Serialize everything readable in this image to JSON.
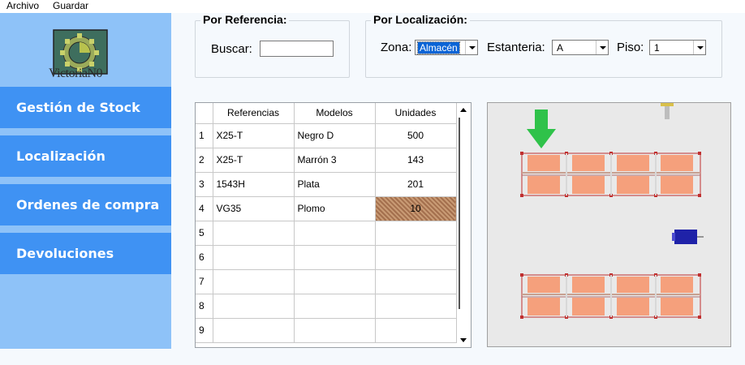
{
  "menu": {
    "items": [
      "Archivo",
      "Guardar"
    ]
  },
  "sidebar": {
    "logo_text": "VictoriaN0",
    "items": [
      {
        "label": "Gestión de Stock"
      },
      {
        "label": "Localización"
      },
      {
        "label": "Ordenes de compra"
      },
      {
        "label": "Devoluciones"
      }
    ]
  },
  "by_reference": {
    "title": "Por Referencia:",
    "search_label": "Buscar:",
    "search_value": ""
  },
  "by_location": {
    "title": "Por Localización:",
    "zone_label": "Zona:",
    "zone_value": "Almacén",
    "shelf_label": "Estanteria:",
    "shelf_value": "A",
    "floor_label": "Piso:",
    "floor_value": "1"
  },
  "table": {
    "headers": [
      "Referencias",
      "Modelos",
      "Unidades"
    ],
    "rows": [
      {
        "n": "1",
        "ref": "X25-T",
        "model": "Negro D",
        "units": "500"
      },
      {
        "n": "2",
        "ref": "X25-T",
        "model": "Marrón 3",
        "units": "143"
      },
      {
        "n": "3",
        "ref": "1543H",
        "model": "Plata",
        "units": "201"
      },
      {
        "n": "4",
        "ref": "VG35",
        "model": "Plomo",
        "units": "10"
      },
      {
        "n": "5",
        "ref": "",
        "model": "",
        "units": ""
      },
      {
        "n": "6",
        "ref": "",
        "model": "",
        "units": ""
      },
      {
        "n": "7",
        "ref": "",
        "model": "",
        "units": ""
      },
      {
        "n": "8",
        "ref": "",
        "model": "",
        "units": ""
      },
      {
        "n": "9",
        "ref": "",
        "model": "",
        "units": ""
      }
    ]
  },
  "colors": {
    "sidebar_bg": "#8ec2f8",
    "sidebar_button": "#3f92f3",
    "shelf_fill": "#f5a07c",
    "shelf_frame": "#c03030",
    "arrow": "#2fc24a",
    "forklift": "#1f22a8"
  }
}
